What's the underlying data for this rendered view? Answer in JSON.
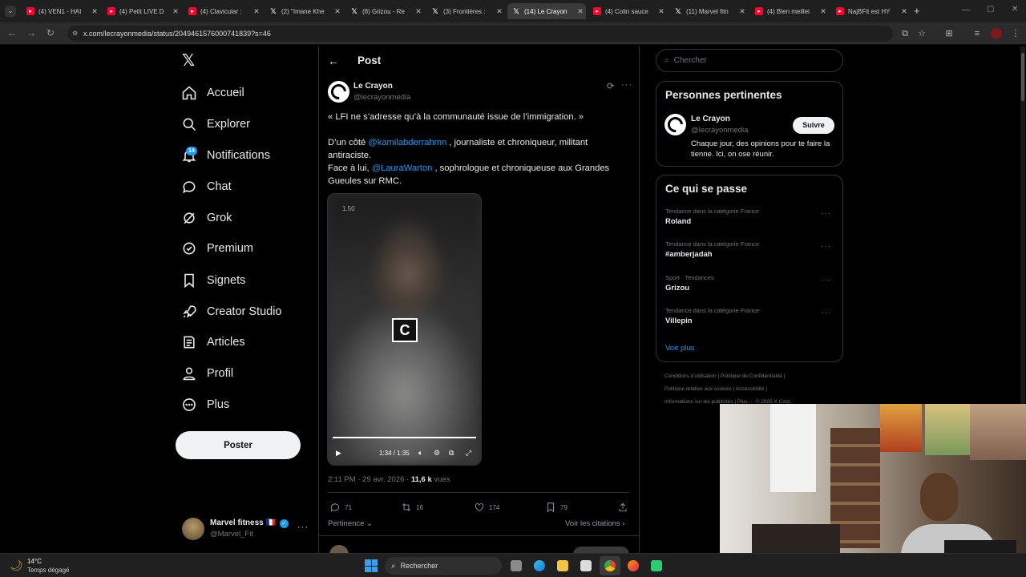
{
  "browser": {
    "tabs": [
      {
        "label": "(4) VEN1 - HAI",
        "icon": "youtube-icon",
        "active": false
      },
      {
        "label": "(4) Petit LIVE D",
        "icon": "youtube-icon",
        "active": false
      },
      {
        "label": "(4) Clavicular :",
        "icon": "youtube-icon",
        "active": false
      },
      {
        "label": "(2) \"Imane Khe",
        "icon": "x-icon",
        "active": false
      },
      {
        "label": "(8) Grizou - Re",
        "icon": "x-icon",
        "active": false
      },
      {
        "label": "(3) Frontières :",
        "icon": "x-icon",
        "active": false
      },
      {
        "label": "(14) Le Crayon",
        "icon": "x-icon",
        "active": true
      },
      {
        "label": "(4) Colin sauce",
        "icon": "youtube-icon",
        "active": false
      },
      {
        "label": "(11) Marvel fitn",
        "icon": "x-icon",
        "active": false
      },
      {
        "label": "(4) Bien meillei",
        "icon": "youtube-icon",
        "active": false
      },
      {
        "label": "NajBFit est HY",
        "icon": "youtube-icon",
        "active": false
      }
    ],
    "url": "x.com/lecrayonmedia/status/2049461576000741839?s=46"
  },
  "nav": {
    "items": [
      {
        "label": "Accueil",
        "icon": "home-icon"
      },
      {
        "label": "Explorer",
        "icon": "search-icon"
      },
      {
        "label": "Notifications",
        "icon": "bell-icon"
      },
      {
        "label": "Chat",
        "icon": "chat-icon"
      },
      {
        "label": "Grok",
        "icon": "grok-icon"
      },
      {
        "label": "Premium",
        "icon": "premium-icon"
      },
      {
        "label": "Signets",
        "icon": "bookmark-icon"
      },
      {
        "label": "Creator Studio",
        "icon": "rocket-icon"
      },
      {
        "label": "Articles",
        "icon": "article-icon"
      },
      {
        "label": "Profil",
        "icon": "person-icon"
      },
      {
        "label": "Plus",
        "icon": "more-circle-icon"
      }
    ],
    "notif_count": "14",
    "post_button": "Poster",
    "account": {
      "name": "Marvel fitness 🇫🇷",
      "handle": "@Marvel_Fit"
    }
  },
  "post": {
    "header_title": "Post",
    "author": {
      "name": "Le Crayon",
      "handle": "@lecrayonmedia"
    },
    "quote": "« LFI ne s’adresse qu’à la communauté issue de l’immigration. »",
    "line1_pre": "D’un côté ",
    "line1_mention": "@kamilabderrahmn",
    "line1_post": " , journaliste et chroniqueur, militant antiraciste.",
    "line2_pre": "Face à lui, ",
    "line2_mention": "@LauraWarton",
    "line2_post": " , sophrologue et chroniqueuse aux Grandes Gueules sur RMC.",
    "video": {
      "top_label": "1.50",
      "time": "1:34 / 1:35",
      "logo": "C"
    },
    "meta": {
      "time": "2:11 PM · 29 avr. 2026 · ",
      "views": "11,6 k",
      "views_label": " vues"
    },
    "stats": {
      "replies": "71",
      "reposts": "16",
      "likes": "174",
      "bookmarks": "79"
    },
    "sort_label": "Pertinence",
    "quotes_link": "Voir les citations"
  },
  "sidebar": {
    "search_placeholder": "Chercher",
    "relevant": {
      "title": "Personnes pertinentes",
      "name": "Le Crayon",
      "handle": "@lecrayonmedia",
      "bio": "Chaque jour, des opinions pour te faire la tienne. Ici, on ose réunir.",
      "follow": "Suivre"
    },
    "trends": {
      "title": "Ce qui se passe",
      "items": [
        {
          "category": "Tendance dans la catégorie France",
          "name": "Roland"
        },
        {
          "category": "Tendance dans la catégorie France",
          "name": "#amberjadah"
        },
        {
          "category": "Sport · Tendances",
          "name": "Grizou"
        },
        {
          "category": "Tendance dans la catégorie France",
          "name": "Villepin"
        }
      ],
      "show_more": "Voir plus"
    },
    "footer": {
      "line1": "Conditions d’utilisation  |  Politique de Confidentialité  |",
      "line2": "Politique relative aux cookies  |  Accessibilité  |",
      "line3": "Informations sur les publicités  |  Plus ···  © 2026 X Corp."
    }
  },
  "taskbar": {
    "weather_temp": "14°C",
    "weather_desc": "Temps dégagé",
    "search": "Rechercher"
  }
}
